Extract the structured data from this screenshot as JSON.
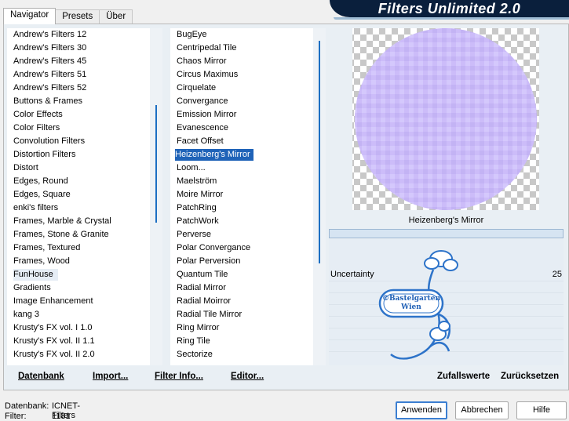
{
  "tabs": [
    "Navigator",
    "Presets",
    "Über"
  ],
  "banner": "Filters Unlimited 2.0",
  "categories": [
    "Andrew's Filters 12",
    "Andrew's Filters 30",
    "Andrew's Filters 45",
    "Andrew's Filters 51",
    "Andrew's Filters 52",
    "Buttons & Frames",
    "Color Effects",
    "Color Filters",
    "Convolution Filters",
    "Distortion Filters",
    "Distort",
    "Edges, Round",
    "Edges, Square",
    "enki's filters",
    "Frames, Marble & Crystal",
    "Frames, Stone & Granite",
    "Frames, Textured",
    "Frames, Wood",
    "FunHouse",
    "Gradients",
    "Image Enhancement",
    "kang 3",
    "Krusty's FX vol. I 1.0",
    "Krusty's FX vol. II 1.1",
    "Krusty's FX vol. II 2.0"
  ],
  "category_selected": "FunHouse",
  "filters": [
    "BugEye",
    "Centripedal Tile",
    "Chaos Mirror",
    "Circus Maximus",
    "Cirquelate",
    "Convergance",
    "Emission Mirror",
    "Evanescence",
    "Facet Offset",
    "Heizenberg's Mirror",
    "Loom...",
    "Maelström",
    "Moire Mirror",
    "PatchRing",
    "PatchWork",
    "Perverse",
    "Polar Convergance",
    "Polar Perversion",
    "Quantum Tile",
    "Radial Mirror",
    "Radial Moirror",
    "Radial Tile Mirror",
    "Ring Mirror",
    "Ring Tile",
    "Sectorize"
  ],
  "filter_selected": "Heizenberg's Mirror",
  "toolbar": {
    "database": "Datenbank",
    "import": "Import...",
    "filter_info": "Filter Info...",
    "editor": "Editor..."
  },
  "preview": {
    "filter_name": "Heizenberg's Mirror",
    "watermark": "©Bastelgarten Wien"
  },
  "params": [
    {
      "label": "Uncertainty",
      "value": "25"
    }
  ],
  "right_actions": {
    "random": "Zufallswerte",
    "reset": "Zurücksetzen"
  },
  "footer": {
    "db_label": "Datenbank:",
    "db_value": "ICNET-Filters",
    "filter_label": "Filter:",
    "filter_value": "1181",
    "apply": "Anwenden",
    "cancel": "Abbrechen",
    "help": "Hilfe"
  },
  "colors": {
    "accent": "#1f63b8",
    "banner": "#0a1f3c",
    "preview_fill": "#c9b8f7"
  }
}
